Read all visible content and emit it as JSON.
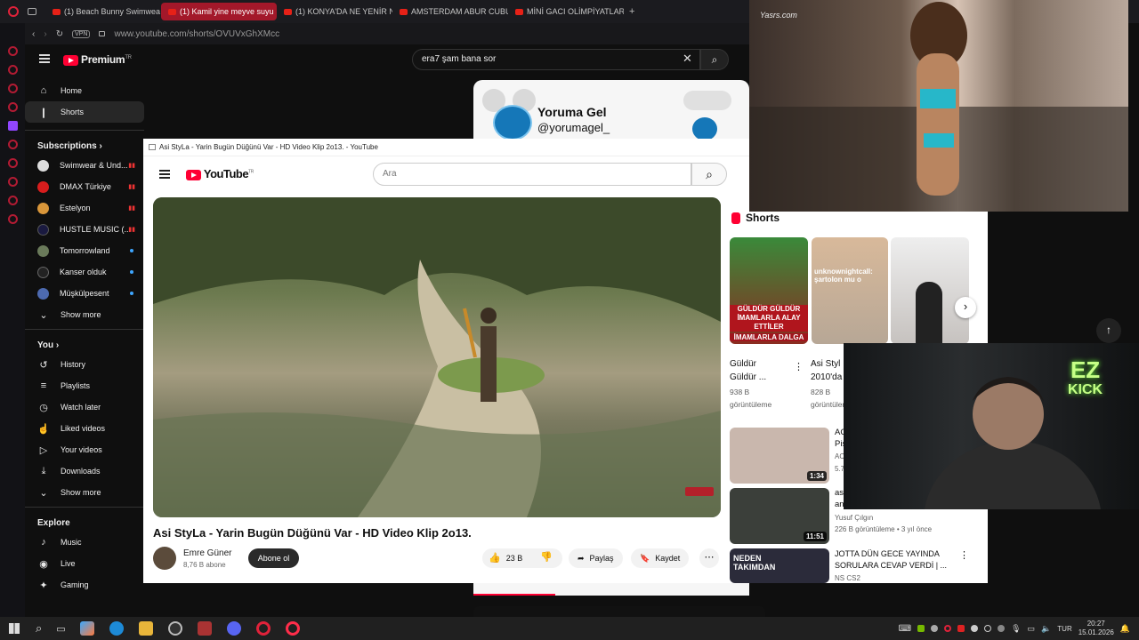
{
  "browser": {
    "tabs": [
      {
        "label": "(1) Beach Bunny Swimwea"
      },
      {
        "label": "(1) Kamil yine meyve suyu"
      },
      {
        "label": "(1) KONYA'DA NE YENİR N"
      },
      {
        "label": "AMSTERDAM ABUR CUBU"
      },
      {
        "label": "MİNİ GACI OLİMPİYATLAR"
      }
    ],
    "vpn": "VPN",
    "url": "www.youtube.com/shorts/OVUVxGhXMcc"
  },
  "yt": {
    "brand": "Premium",
    "brand_sup": "TR",
    "search_value": "era7 şam bana sor",
    "nav": [
      {
        "icon": "home-icon",
        "glyph": "⌂",
        "label": "Home"
      },
      {
        "icon": "shorts-icon",
        "glyph": "❙",
        "label": "Shorts"
      }
    ],
    "subscriptions_title": "Subscriptions",
    "subscriptions": [
      {
        "label": "Swimwear & Und...",
        "color": "#dddddd"
      },
      {
        "label": "DMAX Türkiye",
        "color": "#d81d1d"
      },
      {
        "label": "Estelyon",
        "color": "#d9963a"
      },
      {
        "label": "HUSTLE MUSIC (...",
        "color": "#1a1a40"
      },
      {
        "label": "Tomorrowland",
        "color": "#6a7a5a"
      },
      {
        "label": "Kanser olduk",
        "color": "#222222"
      },
      {
        "label": "Müşkülpesent",
        "color": "#4d6ab0"
      }
    ],
    "show_more": "Show more",
    "you_title": "You",
    "you": [
      {
        "icon": "history-icon",
        "glyph": "↺",
        "label": "History"
      },
      {
        "icon": "playlists-icon",
        "glyph": "≡",
        "label": "Playlists"
      },
      {
        "icon": "watch-later-icon",
        "glyph": "◷",
        "label": "Watch later"
      },
      {
        "icon": "liked-videos-icon",
        "glyph": "👍",
        "label": "Liked videos"
      },
      {
        "icon": "your-videos-icon",
        "glyph": "▶",
        "label": "Your videos"
      },
      {
        "icon": "downloads-icon",
        "glyph": "⤓",
        "label": "Downloads"
      }
    ],
    "show_more_2": "Show more",
    "explore_title": "Explore",
    "explore": [
      {
        "icon": "music-icon",
        "glyph": "♪",
        "label": "Music"
      },
      {
        "icon": "live-icon",
        "glyph": "◉",
        "label": "Live"
      },
      {
        "icon": "gaming-icon",
        "glyph": "🎮",
        "label": "Gaming"
      }
    ],
    "short_card": {
      "channel_title": "Yoruma Gel",
      "handle": "@yorumagel_"
    }
  },
  "embedded": {
    "window_title": "Asi StyLa - Yarin Bugün Düğünü Var - HD Video Klip 2o13. - YouTube",
    "logo_text": "YouTube",
    "logo_sup": "TR",
    "search_placeholder": "Ara",
    "video_title": "Asi StyLa - Yarin Bugün Düğünü Var - HD Video Klip 2o13.",
    "channel_name": "Emre Güner",
    "subscribers": "8,76 B abone",
    "subscribe": "Abone ol",
    "likes": "23 B",
    "share": "Paylaş",
    "save": "Kaydet"
  },
  "overlay_watermark": "Yasrs.com",
  "webcam_sign": {
    "top": "EZ",
    "bottom": "KICK"
  },
  "shorts_panel": {
    "title": "Shorts",
    "short1_overlay": "GÜLDÜR GÜLDÜR İMAMLARLA ALAY ETTİLER",
    "short1_strip": "İMAMLARLA DALGA",
    "short2_overlay": "unknownightcall: şartolon mu o",
    "short1": {
      "title_1": "Güldür",
      "title_2": "Güldür ...",
      "views_1": "938 B",
      "views_2": "görüntüleme"
    },
    "short2": {
      "title_1": "Asi Styl",
      "title_2": "2010'da",
      "views_1": "828 B",
      "views_2": "görüntüleme"
    },
    "videos": [
      {
        "title_1": "AC",
        "title_2": "Pis",
        "channel": "AC",
        "meta": "5.7",
        "duration": "1:34",
        "color": "#c9b7ad"
      },
      {
        "title_1": "as",
        "title_2": "an",
        "channel": "Yusuf Çılgın",
        "meta": "226 B görüntüleme • 3 yıl önce",
        "duration": "11:51",
        "color": "#3b3f3a"
      },
      {
        "title_1": "JOTTA DÜN GECE YAYINDA",
        "title_2": "SORULARA CEVAP VERDİ | ...",
        "channel": "NS CS2",
        "meta": "",
        "duration": "",
        "color": "#2b2b3a"
      }
    ],
    "video3_thumb_text": "NEDEN TAKIMDAN"
  },
  "taskbar": {
    "lang": "TUR",
    "time": "20:27",
    "date": "15.01.2026"
  }
}
